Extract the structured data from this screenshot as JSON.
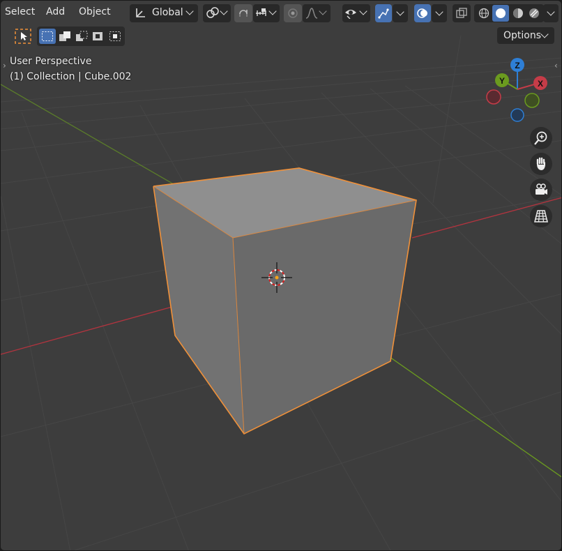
{
  "menu": {
    "select": "Select",
    "add": "Add",
    "object": "Object"
  },
  "transform": {
    "orientation": "Global"
  },
  "options": {
    "label": "Options"
  },
  "viewport": {
    "perspective": "User Perspective",
    "collection_info": "(1) Collection | Cube.002"
  },
  "gizmo": {
    "z": "Z",
    "y": "Y",
    "x": "X"
  },
  "icons": {
    "select-box": "select-box-icon",
    "orientation": "transform-orientation-icon",
    "pivot": "pivot-link-icon",
    "snap": "snap-magnet-icon",
    "proportional": "proportional-editing-icon",
    "visibility": "eye-icon",
    "gizmo": "gizmo-icon",
    "overlays": "overlay-icon",
    "xray": "xray-icon",
    "shading": [
      "wireframe-icon",
      "solid-icon",
      "material-preview-icon",
      "rendered-icon"
    ],
    "zoom": "zoom-in-icon",
    "pan": "hand-icon",
    "camera": "camera-icon",
    "ortho": "grid-perspective-icon"
  },
  "colors": {
    "x_axis": "#c53c48",
    "y_axis": "#6b9b1f",
    "z_axis": "#2e7fd6",
    "selection": "#f0913a",
    "accent_blue": "#4772b3"
  }
}
